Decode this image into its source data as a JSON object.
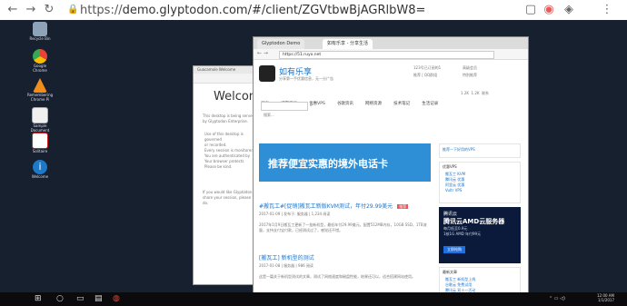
{
  "host": {
    "url_scheme": "https://",
    "url_rest": "demo.glyptodon.com/#/client/ZGVtbwBjAGRlbW8="
  },
  "desktop": {
    "icons": [
      {
        "label": "Recycle Bin",
        "color": "#8fa3b8"
      },
      {
        "label": "Google Chrome",
        "color": "#e94335"
      },
      {
        "label": "Remembering Chrome Pi",
        "color": "#f28c1b"
      },
      {
        "label": "Sample Document",
        "color": "#f0f0f0"
      },
      {
        "label": "Solitaire",
        "color": "#ffffff"
      },
      {
        "label": "Welcome",
        "color": "#1e78c8"
      }
    ]
  },
  "back_window": {
    "tab": "Guacamole Welcome",
    "heading": "Welcome",
    "para": "This desktop is being served by Glyptodon Enterprise.",
    "bullets": [
      "Use of this desktop is governed",
      "or recorded.",
      "Every session is monitored",
      "You are authenticated by",
      "Your browser protects",
      "Please be kind."
    ],
    "footer": "If you would like Glyptodon to share your session, please do."
  },
  "front_window": {
    "tabs": [
      "Glyptodon Demo",
      "如有乐享 - 分享生活"
    ],
    "address": "https://51.ruyo.net",
    "site_name": "如有乐享",
    "site_sub": "分享第一手优惠信息，无一分广告",
    "header_right": [
      "123号已订阅的1",
      "高级会员",
      "推荐 | QQ群组",
      "特别推荐"
    ],
    "nav": [
      "首页",
      "博客工具",
      "优惠VPS",
      "谷歌资讯",
      "网络资源",
      "技术笔记",
      "生活记录"
    ],
    "nav_right": [
      "1.2K",
      "1.2K",
      "联系"
    ],
    "search_placeholder": "搜索...",
    "banner_text": "推荐便宜实惠的境外电话卡",
    "post1_title": "#搬瓦工#[促销]搬瓦工新版KVM测试，年付29.99美元",
    "post1_badge": "推荐",
    "post1_meta": "2017-01-09  |  发布于: 服务器  |  1,234 阅读",
    "post1_body": "2017年1月9日搬瓦工更新了一批新机型，最低年付29.99美元，配置512MB内存，10GB SSD，1TB流量，支持支付宝付款，已经测试过了，感觉还不错。",
    "post2_title": "[搬瓦工] 新机型的测试",
    "post2_meta": "2017-01-08  |  服务器  |  986 阅读",
    "post2_body": "这是一篇关于新机型测试的文章，测试了网络速度和磁盘性能，结果还可以，适合搭建网站使用。",
    "side_box1_title": "推荐一下好用的VPS",
    "side_box2_title": "优惠VPS",
    "side_box2_items": [
      "搬瓦工 KVM",
      "腾讯云 优惠",
      "阿里云 优惠",
      "Vultr VPS"
    ],
    "ad_brand": "腾讯云",
    "ad_line1": "腾讯云AMD云服务器",
    "ad_line2": "每月低至0.9元",
    "ad_line3": "1核1G AMD 年付99元",
    "ad_button": "立即抢购",
    "side_box3_title": "最新文章",
    "side_box3_items": [
      "搬瓦工 新机型上线",
      "谷歌云 免费试用",
      "腾讯云 双十一活动"
    ]
  },
  "taskbar": {
    "time": "12:00 AM",
    "date": "1/1/2017"
  }
}
